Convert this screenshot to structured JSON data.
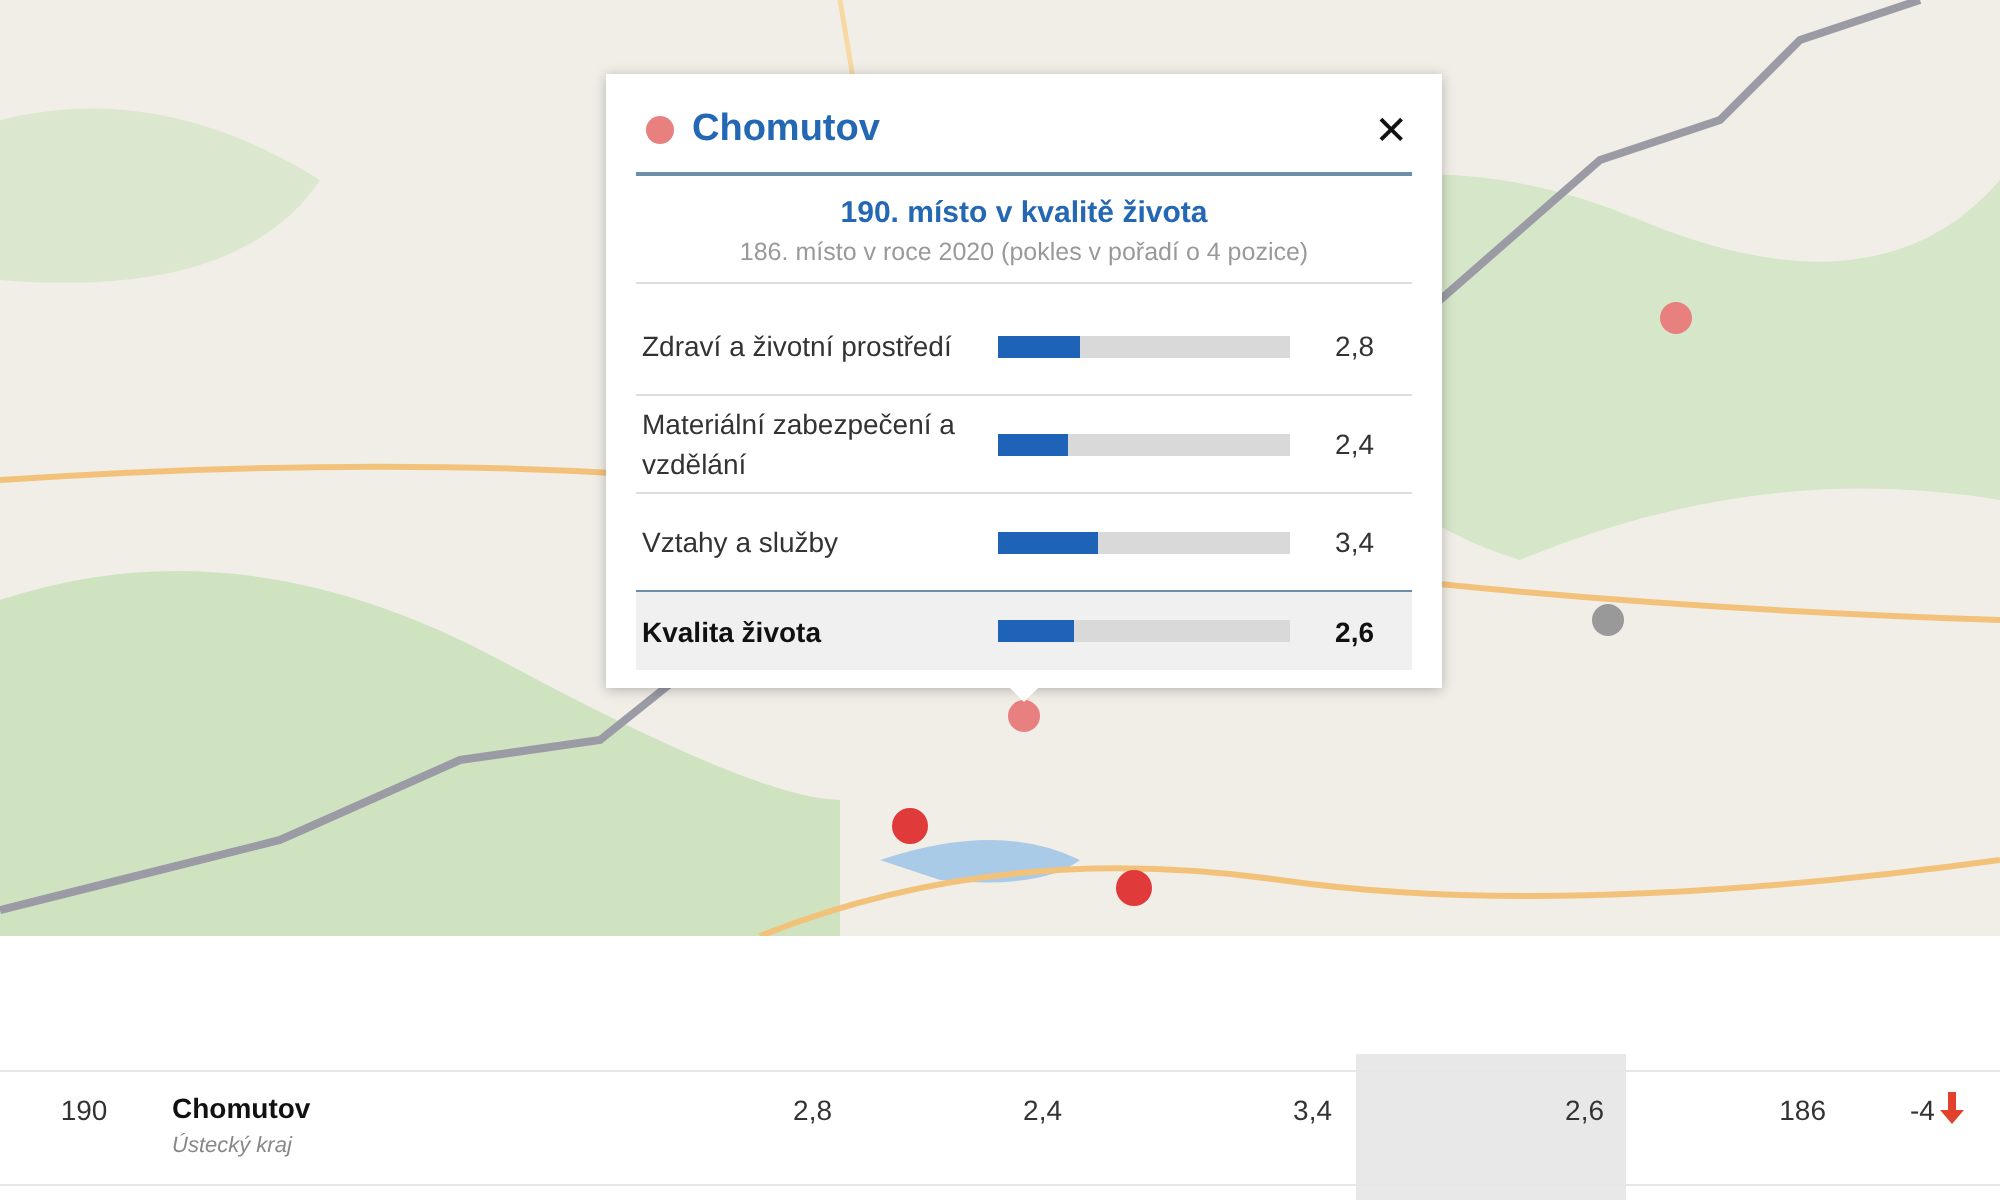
{
  "popup": {
    "title": "Chomutov",
    "color": "#e88080",
    "rank_title": "190. místo v kvalitě života",
    "rank_note": "186. místo v roce 2020 (pokles v pořadí o 4 pozice)",
    "close": "✕",
    "rows": [
      {
        "label": "Zdraví a životní prostředí",
        "level": 0.28,
        "value": "2,8",
        "kind": "item"
      },
      {
        "label": "Materiální zabezpečení a vzdělání",
        "level": 0.24,
        "value": "2,4",
        "kind": "item"
      },
      {
        "label": "Vztahy a služby",
        "level": 0.34,
        "value": "3,4",
        "kind": "item"
      },
      {
        "label": "Kvalita života",
        "level": 0.26,
        "value": "2,6",
        "kind": "total"
      }
    ]
  },
  "table": {
    "rows": [
      {
        "rank": "190",
        "name": "Chomutov",
        "region": "Ústecký kraj",
        "values": [
          "2,8",
          "2,4",
          "3,4",
          "2,6"
        ],
        "previous": "186",
        "change": "-4",
        "falling": true
      }
    ]
  }
}
